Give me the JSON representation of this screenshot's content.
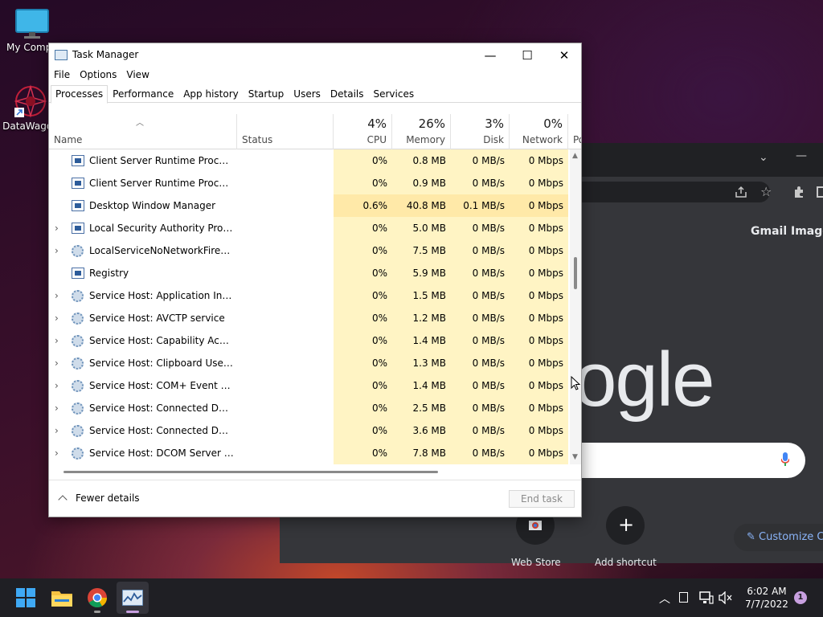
{
  "desktop": {
    "icons": [
      {
        "label": "My Compu"
      },
      {
        "label": "DataWagon"
      }
    ]
  },
  "chrome": {
    "links": [
      "Gmail",
      "Images"
    ],
    "logo_text": "ogle",
    "shortcuts": [
      {
        "label": "Web Store"
      },
      {
        "label": "Add shortcut"
      }
    ],
    "customize_label": "Customize C"
  },
  "task_manager": {
    "title": "Task Manager",
    "window_controls": {
      "minimize": "—",
      "maximize": "☐",
      "close": "✕"
    },
    "menu": [
      "File",
      "Options",
      "View"
    ],
    "tabs": [
      "Processes",
      "Performance",
      "App history",
      "Startup",
      "Users",
      "Details",
      "Services"
    ],
    "active_tab": "Processes",
    "columns": {
      "name": "Name",
      "status": "Status",
      "cpu": {
        "pct": "4%",
        "label": "CPU"
      },
      "memory": {
        "pct": "26%",
        "label": "Memory"
      },
      "disk": {
        "pct": "3%",
        "label": "Disk"
      },
      "network": {
        "pct": "0%",
        "label": "Network"
      },
      "power": "Po"
    },
    "rows": [
      {
        "name": "Client Server Runtime Process",
        "expand": false,
        "icon": "app",
        "cpu": "0%",
        "memory": "0.8 MB",
        "disk": "0 MB/s",
        "network": "0 Mbps"
      },
      {
        "name": "Client Server Runtime Process",
        "expand": false,
        "icon": "app",
        "cpu": "0%",
        "memory": "0.9 MB",
        "disk": "0 MB/s",
        "network": "0 Mbps"
      },
      {
        "name": "Desktop Window Manager",
        "expand": false,
        "icon": "app",
        "cpu": "0.6%",
        "memory": "40.8 MB",
        "disk": "0.1 MB/s",
        "network": "0 Mbps",
        "hot": true
      },
      {
        "name": "Local Security Authority Process...",
        "expand": true,
        "icon": "app",
        "cpu": "0%",
        "memory": "5.0 MB",
        "disk": "0 MB/s",
        "network": "0 Mbps"
      },
      {
        "name": "LocalServiceNoNetworkFirewall ...",
        "expand": true,
        "icon": "gear",
        "cpu": "0%",
        "memory": "7.5 MB",
        "disk": "0 MB/s",
        "network": "0 Mbps"
      },
      {
        "name": "Registry",
        "expand": false,
        "icon": "app",
        "cpu": "0%",
        "memory": "5.9 MB",
        "disk": "0 MB/s",
        "network": "0 Mbps"
      },
      {
        "name": "Service Host: Application Infor...",
        "expand": true,
        "icon": "gear",
        "cpu": "0%",
        "memory": "1.5 MB",
        "disk": "0 MB/s",
        "network": "0 Mbps"
      },
      {
        "name": "Service Host: AVCTP service",
        "expand": true,
        "icon": "gear",
        "cpu": "0%",
        "memory": "1.2 MB",
        "disk": "0 MB/s",
        "network": "0 Mbps"
      },
      {
        "name": "Service Host: Capability Access ...",
        "expand": true,
        "icon": "gear",
        "cpu": "0%",
        "memory": "1.4 MB",
        "disk": "0 MB/s",
        "network": "0 Mbps"
      },
      {
        "name": "Service Host: Clipboard User Ser...",
        "expand": true,
        "icon": "gear",
        "cpu": "0%",
        "memory": "1.3 MB",
        "disk": "0 MB/s",
        "network": "0 Mbps"
      },
      {
        "name": "Service Host: COM+ Event Syste...",
        "expand": true,
        "icon": "gear",
        "cpu": "0%",
        "memory": "1.4 MB",
        "disk": "0 MB/s",
        "network": "0 Mbps"
      },
      {
        "name": "Service Host: Connected Device...",
        "expand": true,
        "icon": "gear",
        "cpu": "0%",
        "memory": "2.5 MB",
        "disk": "0 MB/s",
        "network": "0 Mbps"
      },
      {
        "name": "Service Host: Connected Device...",
        "expand": true,
        "icon": "gear",
        "cpu": "0%",
        "memory": "3.6 MB",
        "disk": "0 MB/s",
        "network": "0 Mbps"
      },
      {
        "name": "Service Host: DCOM Server Proc...",
        "expand": true,
        "icon": "gear",
        "cpu": "0%",
        "memory": "7.8 MB",
        "disk": "0 MB/s",
        "network": "0 Mbps"
      }
    ],
    "footer": {
      "fewer_details": "Fewer details",
      "end_task": "End task"
    }
  },
  "taskbar": {
    "apps": [
      "start-icon",
      "file-explorer-icon",
      "chrome-icon",
      "task-manager-icon"
    ],
    "clock_time": "6:02 AM",
    "clock_date": "7/7/2022",
    "notification_count": "1"
  }
}
